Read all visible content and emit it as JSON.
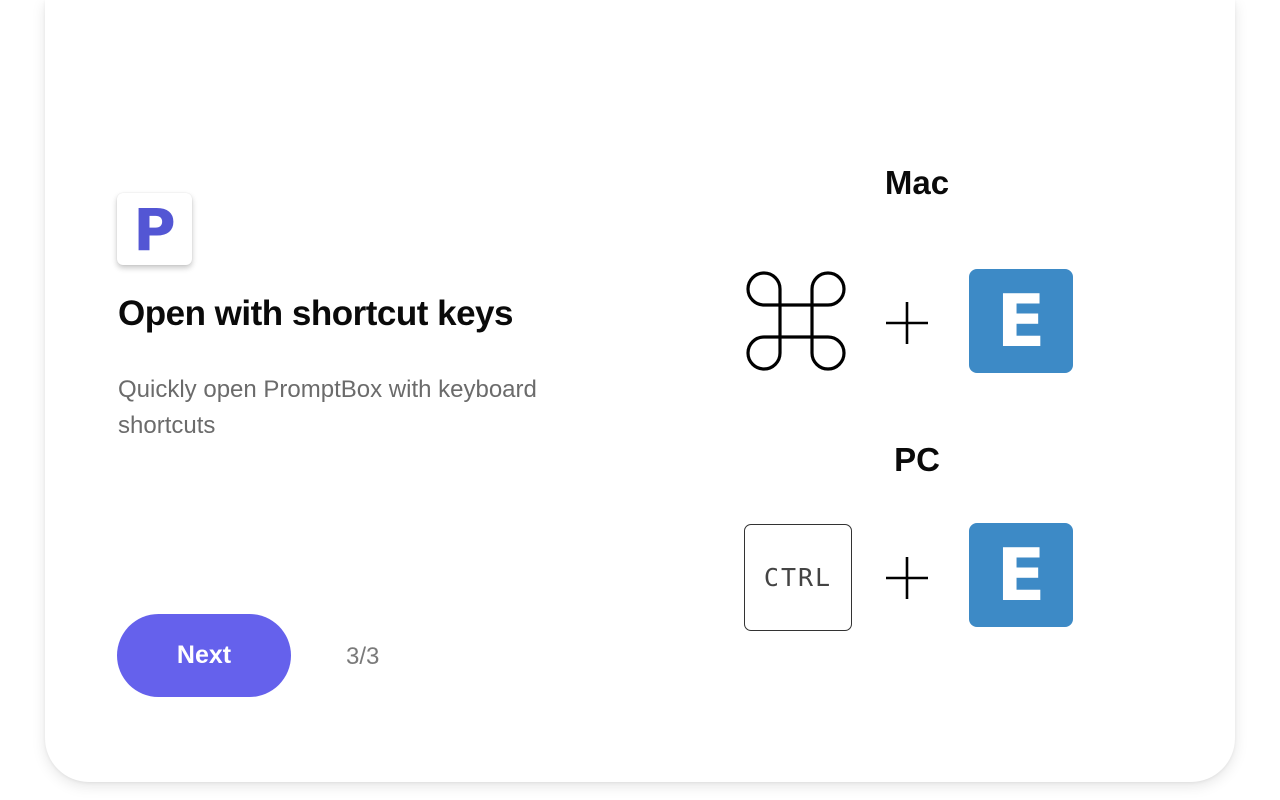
{
  "onboarding": {
    "logo_letter": "P",
    "title": "Open with shortcut keys",
    "subtitle": "Quickly open PromptBox with keyboard shortcuts",
    "next_label": "Next",
    "page_indicator": "3/3"
  },
  "shortcuts": {
    "mac": {
      "label": "Mac",
      "modifier_icon": "command-icon",
      "key": "E"
    },
    "pc": {
      "label": "PC",
      "modifier": "CTRL",
      "key": "E"
    }
  },
  "colors": {
    "accent": "#6561ec",
    "logo": "#5356d4",
    "key_blue": "#3d8ac6",
    "title": "#0a0a0a",
    "subtitle": "#6b6b6b"
  }
}
